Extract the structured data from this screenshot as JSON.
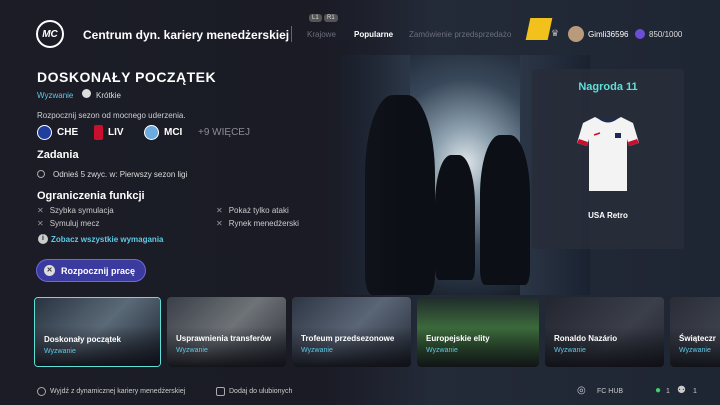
{
  "header": {
    "logo": "MC",
    "title": "Centrum dyn. kariery menedżerskiej",
    "lb": "L1",
    "rb": "R1",
    "tabs": [
      "Krajowe",
      "Popularne",
      "Zamówienie przedsprzedażo"
    ],
    "username": "Gimli36596",
    "coins": "850/1000"
  },
  "challenge": {
    "title": "DOSKONAŁY POCZĄTEK",
    "type": "Wyzwanie",
    "duration": "Krótkie",
    "description": "Rozpocznij sezon od mocnego uderzenia.",
    "clubs": [
      "CHE",
      "LIV",
      "MCI"
    ],
    "more_clubs": "+9 WIĘCEJ",
    "tasks_heading": "Zadania",
    "task": "Odnieś 5 zwyc. w: Pierwszy sezon ligi",
    "limits_heading": "Ograniczenia funkcji",
    "limits": [
      "Szybka symulacja",
      "Pokaż tylko ataki",
      "Symuluj mecz",
      "Rynek menedżerski"
    ],
    "requirements_link": "Zobacz wszystkie wymagania",
    "start_button": "Rozpocznij pracę"
  },
  "reward": {
    "title": "Nagroda 11",
    "item": "USA Retro"
  },
  "cards": [
    {
      "title": "Doskonały początek",
      "subtitle": "Wyzwanie"
    },
    {
      "title": "Usprawnienia transferów",
      "subtitle": "Wyzwanie"
    },
    {
      "title": "Trofeum przedsezonowe",
      "subtitle": "Wyzwanie"
    },
    {
      "title": "Europejskie elity",
      "subtitle": "Wyzwanie"
    },
    {
      "title": "Ronaldo Nazário",
      "subtitle": "Wyzwanie"
    },
    {
      "title": "Świąteczr",
      "subtitle": "Wyzwanie"
    }
  ],
  "footer": {
    "exit": "Wyjdź z dynamicznej kariery menedżerskiej",
    "favorite": "Dodaj do ulubionych",
    "hub": "FC HUB",
    "count1": "1",
    "count2": "1"
  },
  "colors": {
    "accent": "#5ec9e7",
    "reward": "#5ee0d8",
    "button": "#3b3a9e"
  }
}
